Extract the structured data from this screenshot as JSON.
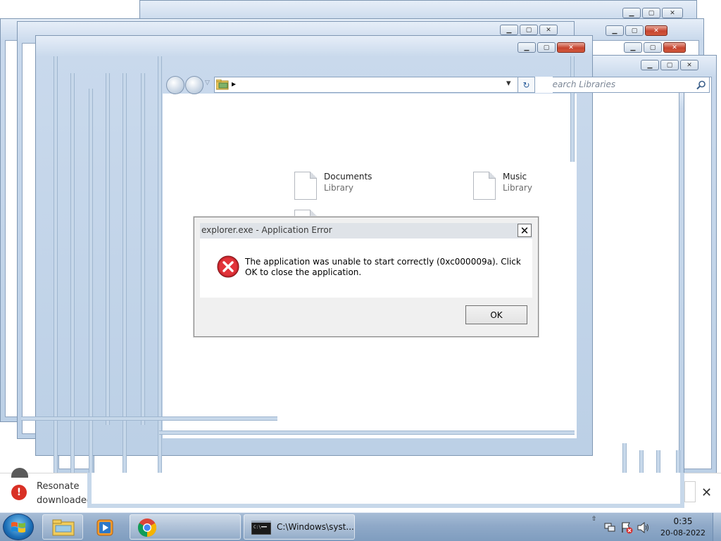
{
  "address_bar": {
    "path_arrow": "▸",
    "dropdown": "▾",
    "refresh": "↻"
  },
  "search": {
    "placeholder": "Search Libraries"
  },
  "library": [
    {
      "name": "Documents",
      "type": "Library"
    },
    {
      "name": "Music",
      "type": "Library"
    }
  ],
  "dialog": {
    "title": "explorer.exe - Application Error",
    "message": "The application was unable to start correctly (0xc000009a). Click OK to close the application.",
    "ok_label": "OK",
    "close_glyph": "✕"
  },
  "notification": {
    "line1": "Resonate",
    "line2": "downloaded",
    "close_glyph": "✕"
  },
  "taskbar": {
    "cmd_label": "C:\\Windows\\syst...",
    "time": "0:35",
    "date": "20-08-2022"
  },
  "colors": {
    "error_red": "#d93025",
    "taskbar": "#8fa9c8",
    "window_frame": "#c9d9ec"
  }
}
